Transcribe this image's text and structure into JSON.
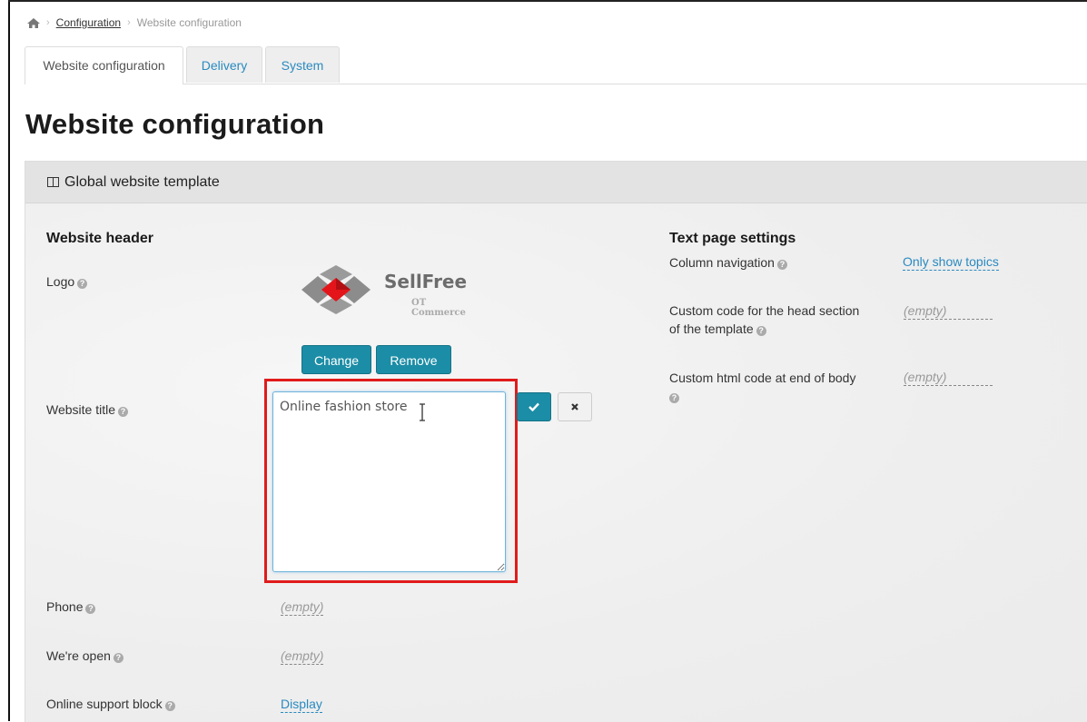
{
  "breadcrumb": {
    "items": [
      "Configuration",
      "Website configuration"
    ]
  },
  "tabs": [
    {
      "label": "Website configuration",
      "active": true
    },
    {
      "label": "Delivery",
      "active": false
    },
    {
      "label": "System",
      "active": false
    }
  ],
  "page_title": "Website configuration",
  "panel": {
    "title": "Global website template",
    "left": {
      "section_title": "Website header",
      "logo": {
        "label": "Logo",
        "brand": "SellFree",
        "tagline": "OT Commerce",
        "change_label": "Change",
        "remove_label": "Remove"
      },
      "website_title": {
        "label": "Website title",
        "value": "Online fashion store"
      },
      "phone": {
        "label": "Phone",
        "value": "(empty)"
      },
      "open": {
        "label": "We're open",
        "value": "(empty)"
      },
      "support": {
        "label": "Online support block",
        "value": "Display"
      }
    },
    "right": {
      "section_title": "Text page settings",
      "column_nav": {
        "label": "Column navigation",
        "value": "Only show topics"
      },
      "head_code": {
        "label_line1": "Custom code for the head section",
        "label_line2": "of the template",
        "value": "(empty)"
      },
      "body_code": {
        "label": "Custom html code at end of body",
        "value": "(empty)"
      }
    }
  },
  "colors": {
    "accent": "#1c8da6",
    "link": "#2a8ac0",
    "highlight": "#e01b1b",
    "logo_red": "#e3151a",
    "logo_gray": "#8c8c8c"
  },
  "icons": {
    "home": "home-icon",
    "help": "question-circle-icon",
    "ok": "check-icon",
    "cancel": "times-icon",
    "panel": "columns-icon"
  }
}
